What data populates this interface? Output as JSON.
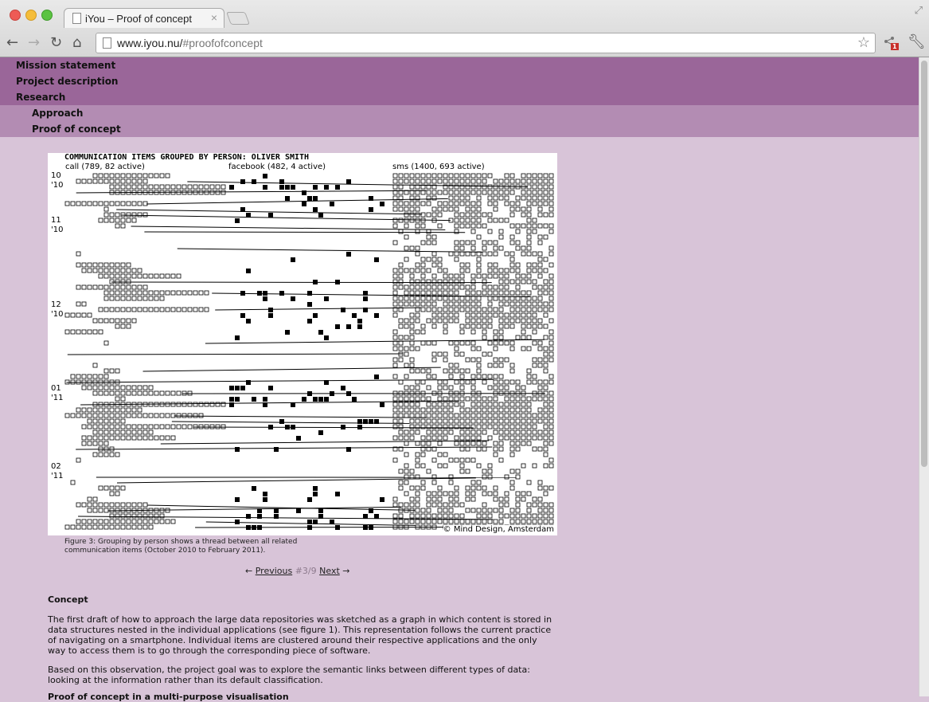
{
  "browser": {
    "tab_title": "iYou – Proof of concept",
    "url_host": "www.iyou.nu/",
    "url_path": "#proofofconcept",
    "extension_badge": "1"
  },
  "menu": {
    "items": [
      "Mission statement",
      "Project description",
      "Research"
    ],
    "subitems": [
      "Approach",
      "Proof of concept"
    ]
  },
  "figure": {
    "title": "COMMUNICATION ITEMS GROUPED BY PERSON: OLIVER SMITH",
    "columns": [
      "call (789, 82 active)",
      "facebook (482, 4 active)",
      "sms (1400, 693 active)"
    ],
    "row_labels": [
      [
        "10",
        "'10"
      ],
      [
        "11",
        "'10"
      ],
      [
        "12",
        "'10"
      ],
      [
        "01",
        "'11"
      ],
      [
        "02",
        "'11"
      ]
    ],
    "credit": "© Mind Design, Amsterdam"
  },
  "caption": "Figure 3: Grouping by person shows a thread between all related communication items (October 2010 to February 2011).",
  "pager": {
    "prev_arrow": "←",
    "prev_label": "Previous",
    "current": "#3/9",
    "next_label": "Next",
    "next_arrow": "→"
  },
  "concept": {
    "heading": "Concept",
    "paragraph1": "The first draft of how to approach the large data repositories was sketched as a graph in which content is stored in data structures nested in the individual applications (see figure 1). This representation follows the current practice of navigating on a smartphone. Individual items are clustered around their respective applications and the only way to access them is to go through the corresponding piece of software.",
    "paragraph2": "Based on this observation, the project goal was to explore the semantic links between different types of data: looking at the information rather than its default classification.",
    "next_heading_partial": "Proof of concept in a multi-purpose visualisation"
  }
}
